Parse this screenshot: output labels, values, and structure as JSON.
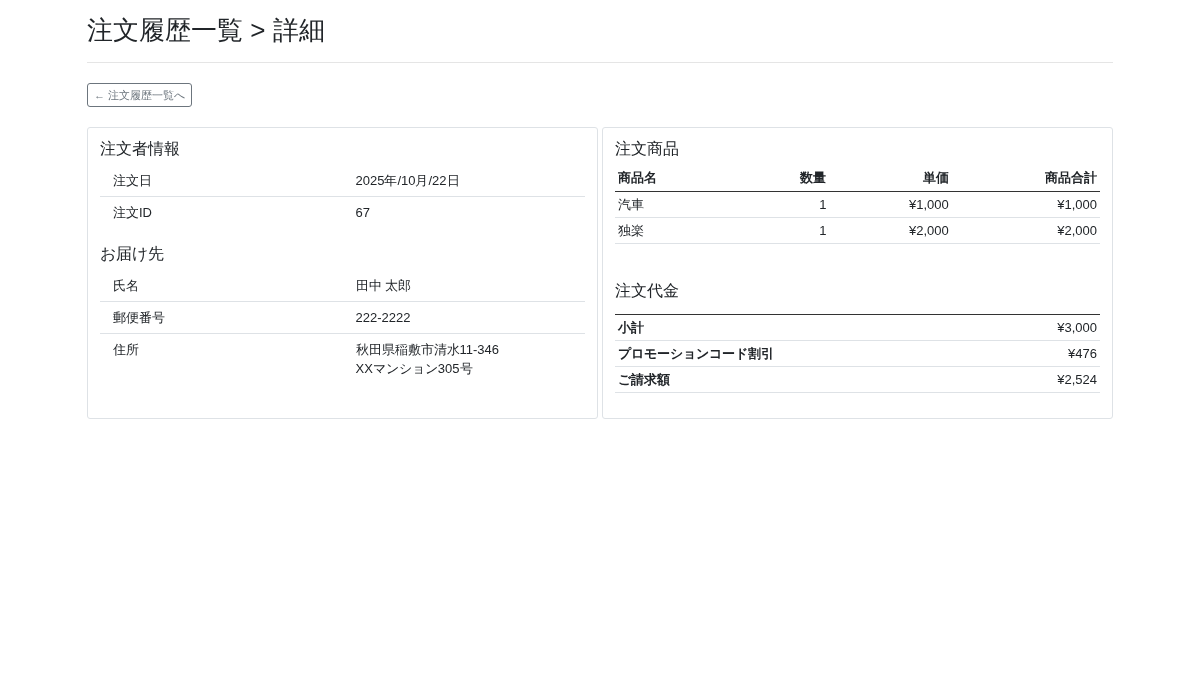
{
  "page": {
    "title": "注文履歴一覧 > 詳細"
  },
  "back_button": {
    "label": "← 注文履歴一覧へ"
  },
  "customer_panel": {
    "sections": [
      {
        "heading": "注文者情報",
        "rows": [
          {
            "label": "注文日",
            "value": "2025年/10月/22日"
          },
          {
            "label": "注文ID",
            "value": "67"
          }
        ]
      },
      {
        "heading": "お届け先",
        "rows": [
          {
            "label": "氏名",
            "value": "田中 太郎"
          },
          {
            "label": "郵便番号",
            "value": "222-2222"
          },
          {
            "label": "住所",
            "value": "秋田県稲敷市清水11-346\nXXマンション305号"
          }
        ]
      }
    ]
  },
  "products_panel": {
    "heading": "注文商品",
    "table": {
      "columns": [
        "商品名",
        "数量",
        "単価",
        "商品合計"
      ],
      "rows": [
        [
          "汽車",
          "1",
          "¥1,000",
          "¥1,000"
        ],
        [
          "独楽",
          "1",
          "¥2,000",
          "¥2,000"
        ]
      ]
    },
    "payment": {
      "heading": "注文代金",
      "rows": [
        {
          "label": "小計",
          "value": "¥3,000"
        },
        {
          "label": "プロモーションコード割引",
          "value": "¥476"
        },
        {
          "label": "ご請求額",
          "value": "¥2,524"
        }
      ]
    }
  }
}
